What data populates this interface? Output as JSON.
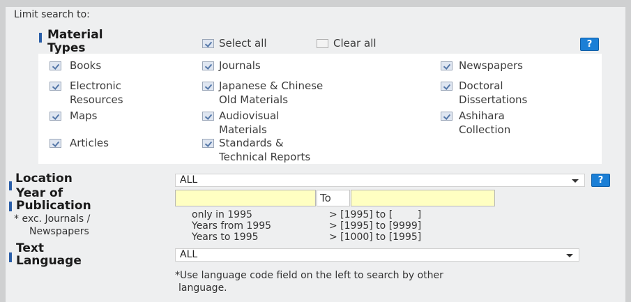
{
  "limit_title": "Limit search to:",
  "material": {
    "label_line1": "Material",
    "label_line2": "Types",
    "select_all": "Select all",
    "clear_all": "Clear all",
    "help": "?",
    "items": [
      {
        "line1": "Books",
        "line2": "",
        "checked": true
      },
      {
        "line1": "Journals",
        "line2": "",
        "checked": true
      },
      {
        "line1": "Newspapers",
        "line2": "",
        "checked": true
      },
      {
        "line1": "Electronic",
        "line2": "Resources",
        "checked": true
      },
      {
        "line1": "Japanese & Chinese",
        "line2": "Old Materials",
        "checked": true
      },
      {
        "line1": "Doctoral",
        "line2": "Dissertations",
        "checked": true
      },
      {
        "line1": "Maps",
        "line2": "",
        "checked": true
      },
      {
        "line1": "Audiovisual",
        "line2": "Materials",
        "checked": true
      },
      {
        "line1": "Ashihara",
        "line2": "Collection",
        "checked": true
      },
      {
        "line1": "Articles",
        "line2": "",
        "checked": true
      },
      {
        "line1": "Standards &",
        "line2": "Technical Reports",
        "checked": true
      }
    ]
  },
  "location": {
    "label": "Location",
    "value": "ALL",
    "help": "?"
  },
  "year": {
    "label_line1": "Year of",
    "label_line2": "Publication",
    "note_line1": "* exc. Journals /",
    "note_line2": "Newspapers",
    "to_label": "To",
    "from_value": "",
    "to_value": "",
    "hint1_left": "only in 1995",
    "hint1_right": "> [1995] to [        ]",
    "hint2_left": "Years from 1995",
    "hint2_right": "> [1995] to [9999]",
    "hint3_left": "Years to 1995",
    "hint3_right": "> [1000] to [1995]"
  },
  "language": {
    "label_line1": "Text",
    "label_line2": "Language",
    "value": "ALL",
    "note_line1": "*Use language code field on the left to search by other",
    "note_line2": "language."
  }
}
